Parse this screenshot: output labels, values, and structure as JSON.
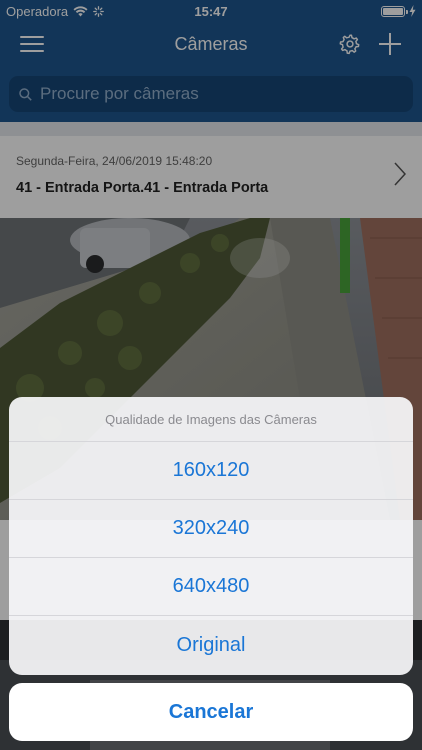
{
  "status_bar": {
    "carrier": "Operadora",
    "time": "15:47",
    "battery_level": 1.0
  },
  "nav": {
    "title": "Câmeras",
    "menu_icon": "hamburger-menu-icon",
    "settings_icon": "gear-icon",
    "add_icon": "plus-icon"
  },
  "search": {
    "placeholder": "Procure por câmeras",
    "icon": "search-icon"
  },
  "camera_card": {
    "date": "Segunda-Feira, 24/06/2019 15:48:20",
    "title": "41 - Entrada Porta.41 - Entrada Porta"
  },
  "action_sheet": {
    "title": "Qualidade de Imagens das Câmeras",
    "options": [
      {
        "label": "160x120"
      },
      {
        "label": "320x240"
      },
      {
        "label": "640x480"
      },
      {
        "label": "Original"
      }
    ],
    "cancel_label": "Cancelar"
  },
  "colors": {
    "header_bg": "#1d568f",
    "accent": "#1a76d6"
  }
}
